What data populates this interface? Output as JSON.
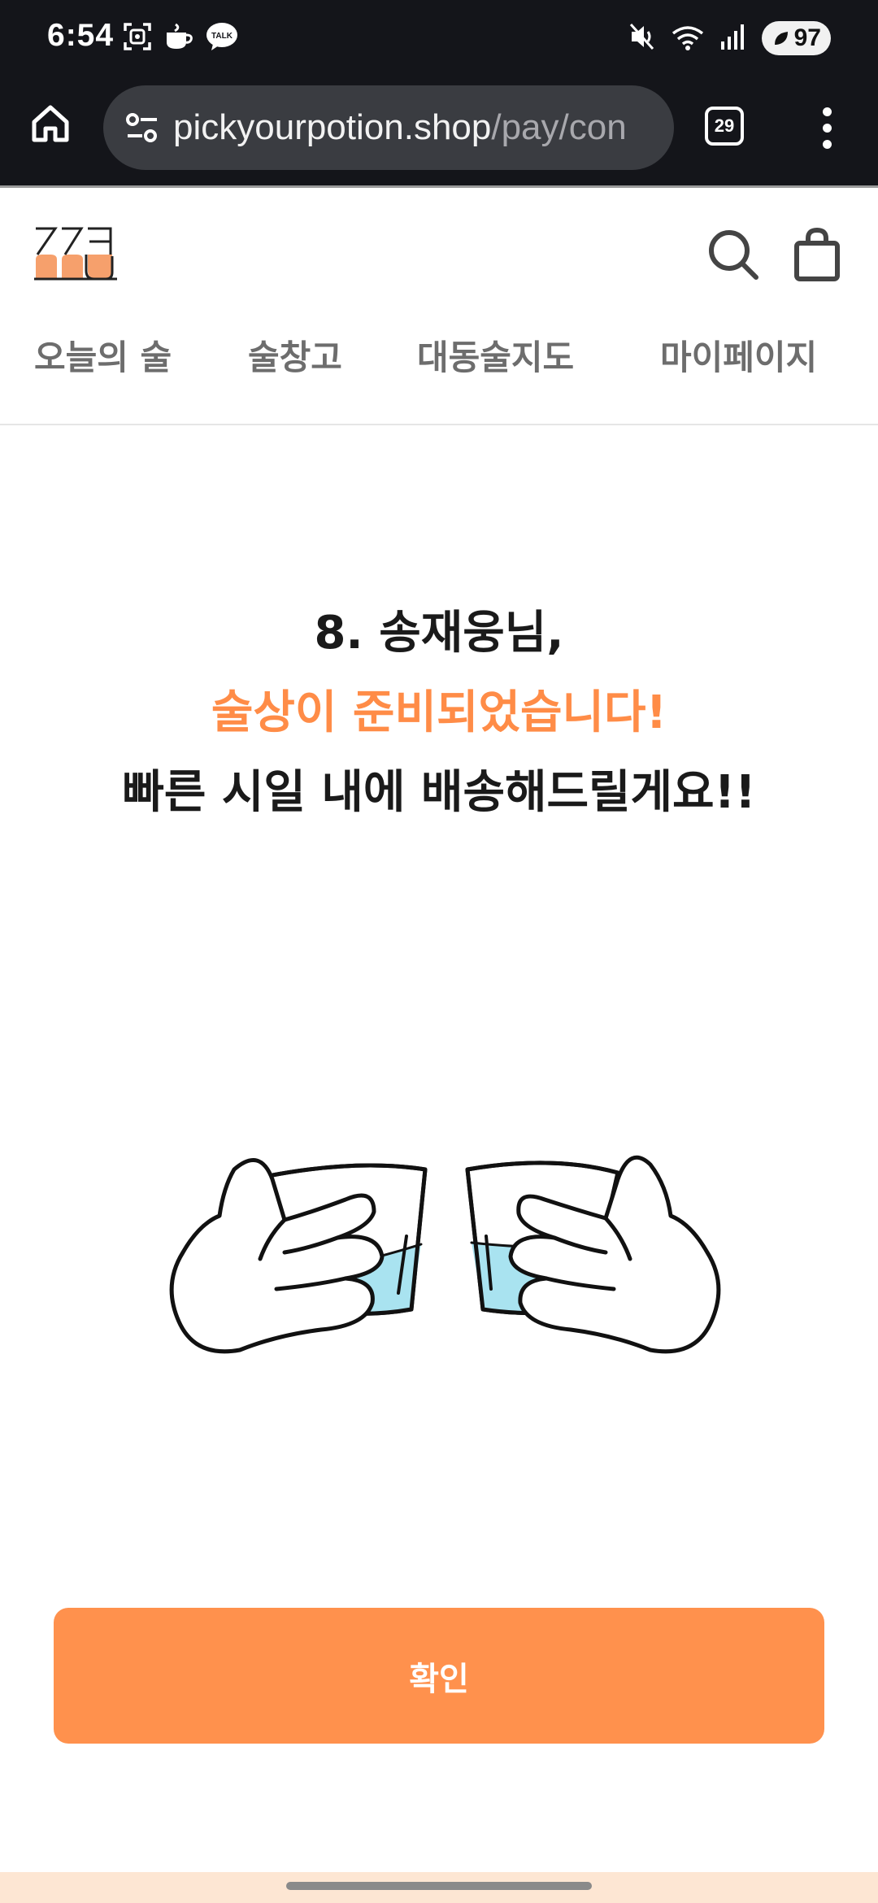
{
  "status_bar": {
    "time": "6:54",
    "left_icons": [
      "screenshot-icon",
      "cafe-app-icon",
      "kakaotalk-icon"
    ],
    "kakao_label": "TALK",
    "right_icons": [
      "mute-icon",
      "wifi-icon",
      "signal-icon"
    ],
    "battery_level": "97"
  },
  "browser": {
    "url_host": "pickyourpotion.shop",
    "url_path": "/pay/con",
    "tab_count": "29"
  },
  "site": {
    "nav_items": [
      "오늘의 술",
      "술창고",
      "대동술지도",
      "마이페이지"
    ]
  },
  "content": {
    "line1": "8. 송재웅님,",
    "line2": "술상이 준비되었습니다!",
    "line3": "빠른 시일 내에 배송해드릴게요!!",
    "illustration": "two-hands-toasting-cups"
  },
  "confirm_button": {
    "label": "확인"
  },
  "colors": {
    "accent": "#ff8c47",
    "button": "#ff914d",
    "status_bar_bg": "#14151a",
    "drink_fill": "#a9e3f0"
  }
}
